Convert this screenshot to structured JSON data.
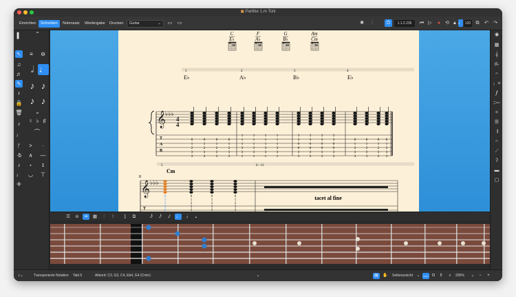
{
  "window": {
    "title": "Partitur 1.m Tonl"
  },
  "toolbar": {
    "tabs": [
      "Einrichten",
      "Schreiben",
      "Notensatz",
      "Wiedergabe",
      "Drucken"
    ],
    "active_tab": 1,
    "instrument": "Guitar",
    "time": "1.1.2.235",
    "tempo": "120"
  },
  "score": {
    "chords_top": [
      {
        "name": "C",
        "bass": "E♭"
      },
      {
        "name": "F",
        "bass": "A♭"
      },
      {
        "name": "G",
        "bass": "B♭"
      },
      {
        "name": "Am",
        "bass": "Cm"
      }
    ],
    "measure_numbers_top": [
      "1",
      "2",
      "3",
      "4"
    ],
    "chord_symbols_system1": [
      "E♭",
      "A♭",
      "B♭",
      "E♭"
    ],
    "tab_label": "T\nA\nB",
    "system2_measure_numbers": [
      "5",
      "6 - 11"
    ],
    "system2_number": "8",
    "system2_chord": "Cm",
    "tacet": "tacet al fine",
    "tab_m1": [
      "0",
      "1",
      "2",
      "3",
      "3"
    ],
    "tab_m2": [
      "1",
      "1",
      "1",
      "3",
      "3",
      "1"
    ],
    "tab_m3": [
      "3",
      "3",
      "0",
      "0",
      "3",
      "3"
    ],
    "tab_m4": [
      "0",
      "1",
      "2",
      "3",
      "3"
    ],
    "tab_s2": [
      "0",
      "1",
      "2",
      "3",
      "3"
    ]
  },
  "status": {
    "left_text": "Transponierte Notation",
    "bar": "Takt 5",
    "chord_info": "Akkord: C3, G3, C4, Eb4, G4 (Cmin)",
    "view": "Seitenansicht",
    "zoom": "200%"
  },
  "colors": {
    "accent": "#2f8ef2",
    "canvas": "#3b9de0",
    "paper": "#fdf0d8"
  }
}
